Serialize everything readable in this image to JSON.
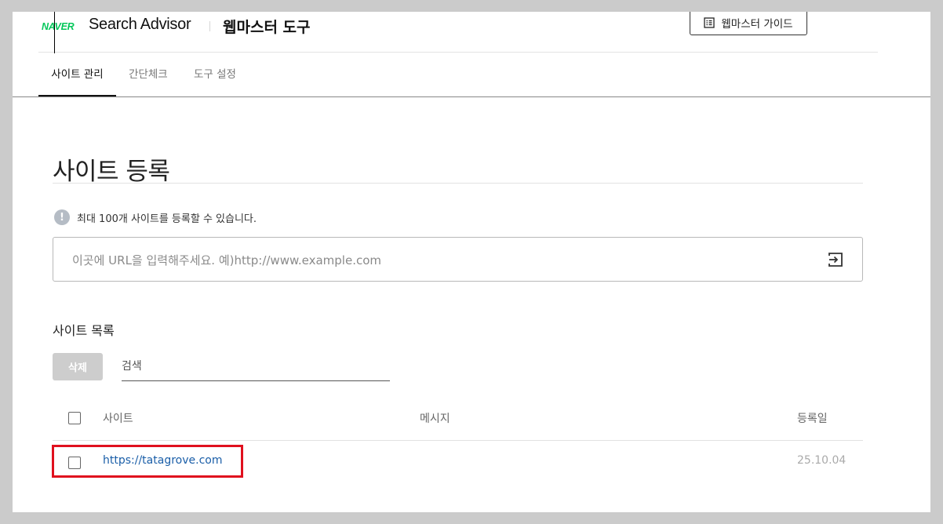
{
  "header": {
    "naver_logo": "NAVER",
    "product_name": "Search Advisor",
    "tool_title": "웹마스터 도구",
    "guide_button_label": "웹마스터 가이드"
  },
  "nav": {
    "tabs": [
      {
        "label": "사이트 관리",
        "active": true
      },
      {
        "label": "간단체크",
        "active": false
      },
      {
        "label": "도구 설정",
        "active": false
      }
    ]
  },
  "main": {
    "title": "사이트 등록",
    "info_text": "최대 100개 사이트를 등록할 수 있습니다.",
    "url_input": {
      "placeholder": "이곳에 URL을 입력해주세요. 예)http://www.example.com",
      "value": ""
    }
  },
  "site_list": {
    "title": "사이트 목록",
    "delete_label": "삭제",
    "search_placeholder": "검색",
    "columns": {
      "site": "사이트",
      "message": "메시지",
      "date": "등록일"
    },
    "rows": [
      {
        "site": "https://tatagrove.com",
        "message": "",
        "date": "25.10.04"
      }
    ]
  },
  "colors": {
    "brand": "#03c75a",
    "link": "#1a5ea8",
    "highlight": "#e0101e"
  },
  "icons": {
    "guide": "document-list-icon",
    "info": "info-icon",
    "submit": "enter-icon"
  }
}
